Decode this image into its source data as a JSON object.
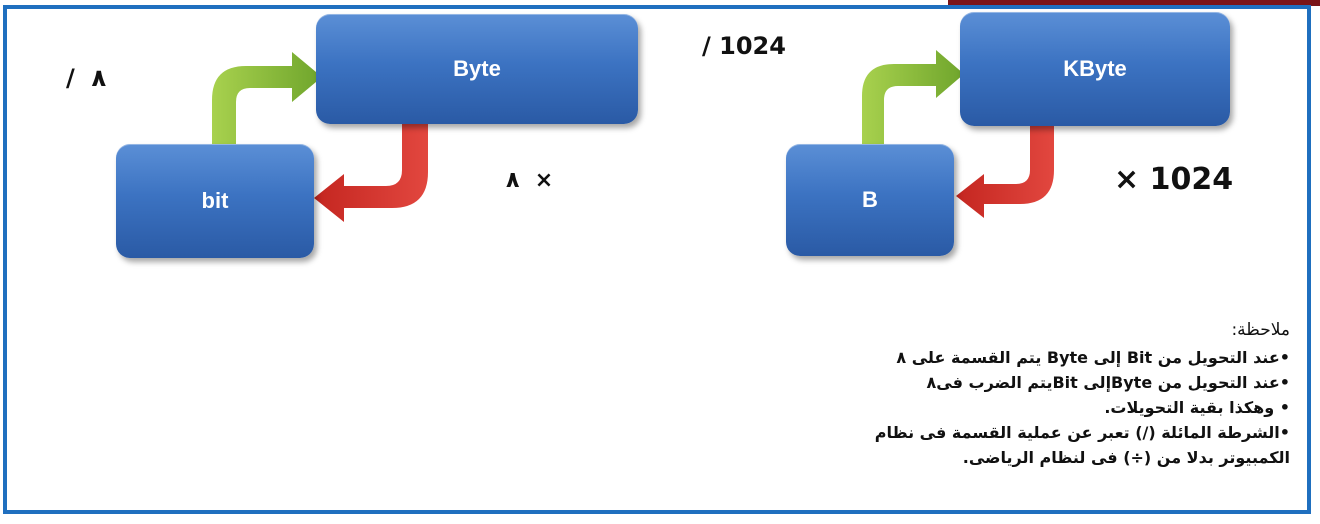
{
  "diagram_left": {
    "top_box": "Byte",
    "bottom_box": "bit",
    "divide_label": "/  ٨",
    "multiply_label": "٨  ×"
  },
  "diagram_right": {
    "top_box": "KByte",
    "bottom_box": "B",
    "divide_label": "/ 1024",
    "multiply_label": "× 1024"
  },
  "colors": {
    "box": "#3c73c2",
    "up_arrow": "#8fbf3a",
    "down_arrow": "#d2322b",
    "frame": "#1f6fbf"
  },
  "note": {
    "title": "ملاحظة:",
    "lines": [
      "•عند التحويل من  Bit إلى Byte يتم القسمة على ٨",
      "•عند التحويل من Byteإلى Bitيتم الضرب فى٨",
      "• وهكذا بقية التحويلات.",
      "•الشرطة المائلة (/) تعبر عن عملية القسمة فى نظام",
      "الكمبيوتر بدلا من (÷) فى لنظام الرياضى."
    ]
  }
}
